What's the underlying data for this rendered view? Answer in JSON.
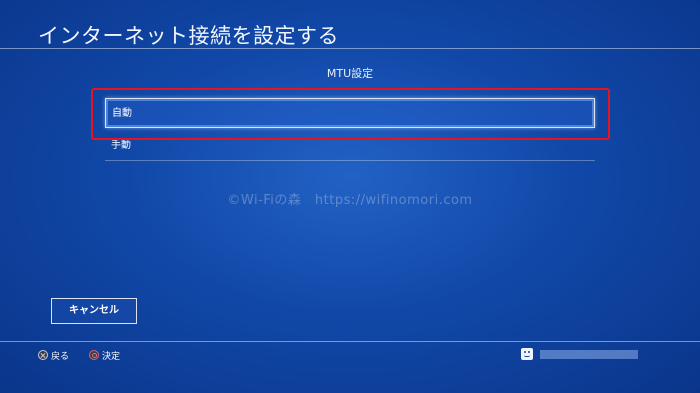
{
  "header": {
    "title": "インターネット接続を設定する"
  },
  "screen": {
    "subtitle": "MTU設定"
  },
  "menu": {
    "items": [
      {
        "label": "自動",
        "selected": true
      },
      {
        "label": "手動",
        "selected": false
      }
    ]
  },
  "watermark": {
    "text": "©Wi-Fiの森　https://wifinomori.com"
  },
  "actions": {
    "cancel_label": "キャンセル"
  },
  "footer": {
    "back_label": "戻る",
    "confirm_label": "決定",
    "back_icon": "cross-button-icon",
    "confirm_icon": "circle-button-icon",
    "user_icon": "user-face-icon"
  },
  "colors": {
    "background": "#1148a8",
    "highlight_annotation": "#e5141e",
    "text": "#ffffff"
  }
}
